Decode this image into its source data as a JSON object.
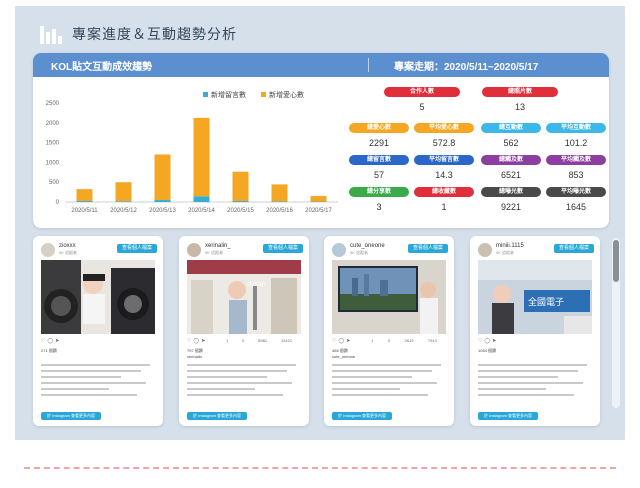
{
  "header": {
    "title": "專案進度＆互動趨勢分析"
  },
  "card": {
    "left_title": "KOL貼文互動成效趨勢",
    "period": "專案走期：2020/5/11~2020/5/17"
  },
  "chart_data": {
    "type": "bar",
    "stacked": true,
    "categories": [
      "2020/5/11",
      "2020/5/12",
      "2020/5/13",
      "2020/5/14",
      "2020/5/15",
      "2020/5/16",
      "2020/5/17"
    ],
    "series": [
      {
        "name": "新增留言數",
        "color": "#35aed6",
        "values": [
          25,
          20,
          50,
          145,
          25,
          15,
          10
        ]
      },
      {
        "name": "新增愛心數",
        "color": "#f5a623",
        "values": [
          300,
          480,
          1150,
          1980,
          740,
          430,
          140
        ]
      }
    ],
    "ylim": [
      0,
      2500
    ],
    "yticks": [
      0,
      500,
      1000,
      1500,
      2000,
      2500
    ],
    "legend": "top-right",
    "grid": false
  },
  "stats": [
    {
      "label": "合作人數",
      "value": "5",
      "color": "#e02e3a"
    },
    {
      "label": "總照片數",
      "value": "13",
      "color": "#e02e3a"
    },
    {
      "label": "總愛心數",
      "value": "2291",
      "color": "#f5a623"
    },
    {
      "label": "平均愛心數",
      "value": "572.8",
      "color": "#f5a623"
    },
    {
      "label": "總互動數",
      "value": "562",
      "color": "#3cb7e8"
    },
    {
      "label": "平均互動數",
      "value": "101.2",
      "color": "#3cb7e8"
    },
    {
      "label": "總留言數",
      "value": "57",
      "color": "#2a67c9"
    },
    {
      "label": "平均留言數",
      "value": "14.3",
      "color": "#2a67c9"
    },
    {
      "label": "總觸及數",
      "value": "6521",
      "color": "#8b3fa0"
    },
    {
      "label": "平均觸及數",
      "value": "853",
      "color": "#8b3fa0"
    },
    {
      "label": "總分享數",
      "value": "3",
      "color": "#3aaa4a"
    },
    {
      "label": "總收藏數",
      "value": "1",
      "color": "#e02e3a"
    },
    {
      "label": "總曝光數",
      "value": "9221",
      "color": "#4a4a4a"
    },
    {
      "label": "平均曝光數",
      "value": "1645",
      "color": "#4a4a4a"
    }
  ],
  "posts": [
    {
      "username": "zioxxx",
      "sub": "5K 追蹤者",
      "button": "查看個人檔案",
      "ig_button": "於 Instagram 查看更多內容",
      "stats": [
        "",
        "",
        "",
        ""
      ],
      "likes": "271 個讚",
      "handle": "",
      "avatar_color": "#d8cfc4",
      "photo": "washer"
    },
    {
      "username": "xerinalin_",
      "sub": "5K 追蹤者",
      "button": "查看個人檔案",
      "ig_button": "於 Instagram 查看更多內容",
      "stats": [
        "1",
        "0",
        "5981",
        "12421"
      ],
      "likes": "797 個讚",
      "handle": "xerinalin",
      "avatar_color": "#c9b8a8",
      "photo": "store"
    },
    {
      "username": "cute_oneone",
      "sub": "5K 追蹤者",
      "button": "查看個人檔案",
      "ig_button": "於 Instagram 查看更多內容",
      "stats": [
        "1",
        "0",
        "2619",
        "7913"
      ],
      "likes": "466 個讚",
      "handle": "cute_oneone",
      "avatar_color": "#b7c9d6",
      "photo": "tv"
    },
    {
      "username": "miniii.1115",
      "sub": "5K 追蹤者",
      "button": "查看個人檔案",
      "ig_button": "於 Instagram 查看更多內容",
      "stats": [
        "",
        "",
        "",
        ""
      ],
      "likes": "1054 個讚",
      "handle": "",
      "avatar_color": "#cbbfb4",
      "photo": "mall"
    }
  ]
}
